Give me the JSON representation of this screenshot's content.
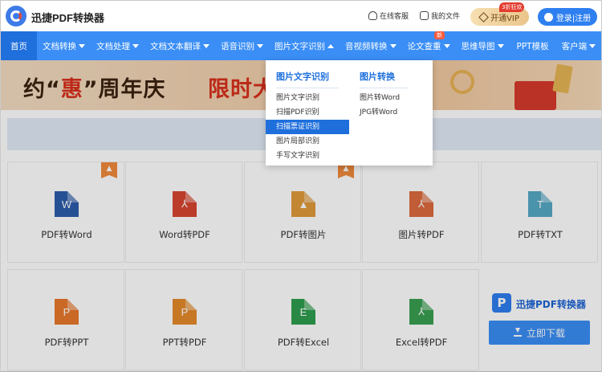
{
  "header": {
    "brand": "迅捷PDF转换器",
    "links": [
      "在线客服",
      "我的文件"
    ],
    "vip_label": "开通VIP",
    "vip_badge": "3折狂欢",
    "login_label": "登录|注册"
  },
  "nav": {
    "items": [
      {
        "label": "首页"
      },
      {
        "label": "文档转换"
      },
      {
        "label": "文档处理"
      },
      {
        "label": "文档文本翻译"
      },
      {
        "label": "语音识别"
      },
      {
        "label": "图片文字识别"
      },
      {
        "label": "音视频转换"
      },
      {
        "label": "论文查重"
      },
      {
        "label": "思维导图"
      },
      {
        "label": "PPT模板"
      },
      {
        "label": "客户端"
      }
    ],
    "new_badge": "新"
  },
  "banner": {
    "text1_a": "约“",
    "text1_b": "惠",
    "text1_c": "”周年庆",
    "text2": "限时大"
  },
  "dropdown": {
    "col1_title": "图片文字识别",
    "col1_items": [
      "图片文字识别",
      "扫描PDF识别",
      "扫描票证识别",
      "图片局部识别",
      "手写文字识别"
    ],
    "col1_active_index": 2,
    "col2_title": "图片转换",
    "col2_items": [
      "图片转Word",
      "JPG转Word"
    ]
  },
  "tools": [
    {
      "label": "PDF转Word",
      "glyph": "W",
      "color": "#2b5cab",
      "hot": true
    },
    {
      "label": "Word转PDF",
      "glyph": "⅄",
      "color": "#d7462f",
      "hot": false
    },
    {
      "label": "PDF转图片",
      "glyph": "▲",
      "color": "#e09a3a",
      "hot": true
    },
    {
      "label": "图片转PDF",
      "glyph": "⅄",
      "color": "#dd6a3f",
      "hot": false
    },
    {
      "label": "PDF转TXT",
      "glyph": "T",
      "color": "#56a9c5",
      "hot": false
    },
    {
      "label": "PDF转PPT",
      "glyph": "P",
      "color": "#e8782b",
      "hot": false
    },
    {
      "label": "PPT转PDF",
      "glyph": "P",
      "color": "#e58a2b",
      "hot": false
    },
    {
      "label": "PDF转Excel",
      "glyph": "E",
      "color": "#2f9e4f",
      "hot": false
    },
    {
      "label": "Excel转PDF",
      "glyph": "⅄",
      "color": "#3a9f52",
      "hot": false
    }
  ],
  "promo": {
    "name": "迅捷PDF转换器",
    "download_label": "立即下载"
  }
}
